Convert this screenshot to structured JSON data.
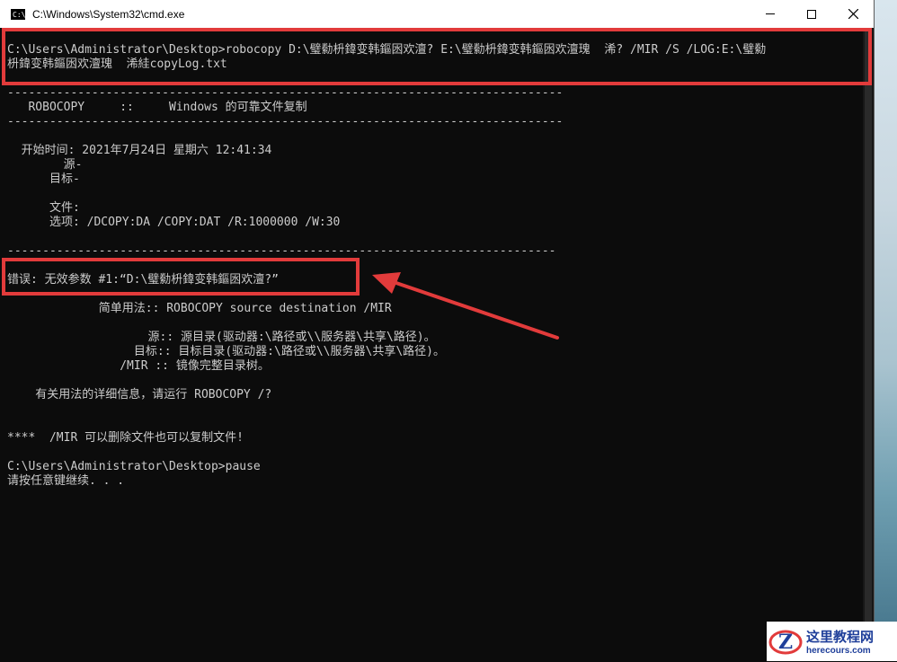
{
  "window": {
    "title": "C:\\Windows\\System32\\cmd.exe",
    "icon_text": "C:\\"
  },
  "console": {
    "lines": [
      "C:\\Users\\Administrator\\Desktop>robocopy D:\\璧勬枡鍏变韩鏂囦欢澶? E:\\璧勬枡鍏变韩鏂囦欢澶瑰  浠? /MIR /S /LOG:E:\\璧勬",
      "枡鍏变韩鏂囦欢澶瑰  浠絓copyLog.txt",
      "-------------------------------------------------------------------------------",
      "   ROBOCOPY     ::     Windows 的可靠文件复制",
      "-------------------------------------------------------------------------------",
      "  开始时间: 2021年7月24日 星期六 12:41:34",
      "        源-",
      "      目标-",
      "      文件:",
      "      选项: /DCOPY:DA /COPY:DAT /R:1000000 /W:30",
      "------------------------------------------------------------------------------",
      "错误: 无效参数 #1:“D:\\璧勬枡鍏变韩鏂囦欢澶?”",
      "             简单用法:: ROBOCOPY source destination /MIR",
      "                    源:: 源目录(驱动器:\\路径或\\\\服务器\\共享\\路径)。",
      "                  目标:: 目标目录(驱动器:\\路径或\\\\服务器\\共享\\路径)。",
      "                /MIR :: 镜像完整目录树。",
      "    有关用法的详细信息，请运行 ROBOCOPY /?",
      "****  /MIR 可以删除文件也可以复制文件!",
      "C:\\Users\\Administrator\\Desktop>pause",
      "请按任意键继续. . ."
    ]
  },
  "watermark": {
    "name_cn": "这里教程网",
    "site": "herecours.com",
    "logo_letter": "Z"
  },
  "colors": {
    "console_bg": "#0c0c0c",
    "console_text": "#cccccc",
    "highlight": "#e23b3b",
    "watermark_blue": "#1f3f9a"
  }
}
